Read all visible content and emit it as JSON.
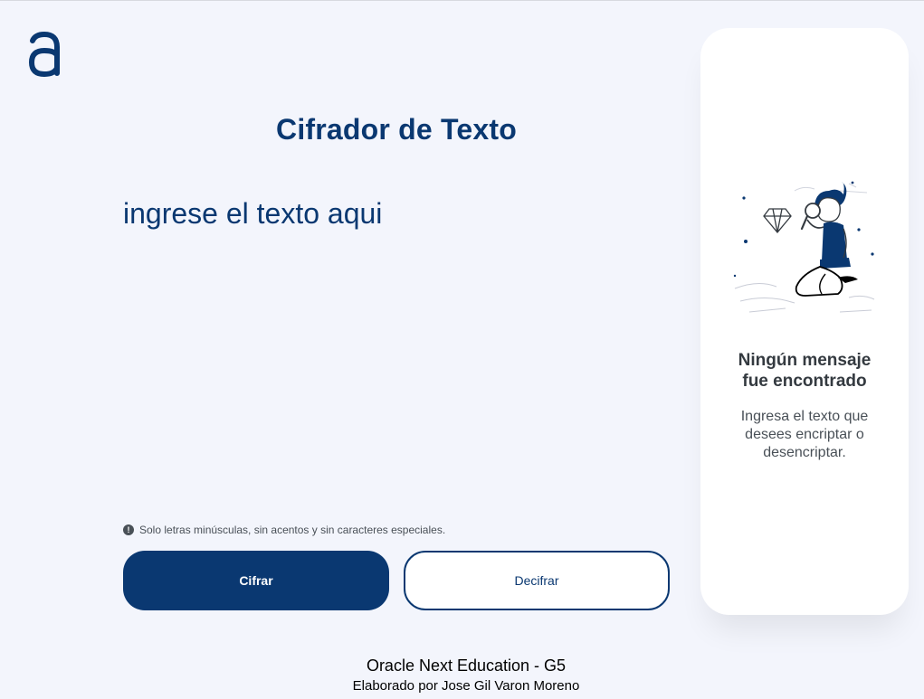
{
  "header": {
    "logo_icon": "alura-logo-icon",
    "title": "Cifrador de Texto"
  },
  "editor": {
    "placeholder": "ingrese el texto aqui",
    "value": ""
  },
  "hint": {
    "icon": "info-icon",
    "text": "Solo letras minúsculas, sin acentos y sin caracteres especiales."
  },
  "actions": {
    "encrypt_label": "Cifrar",
    "decrypt_label": "Decifrar"
  },
  "output_panel": {
    "illustration": "boy-with-magnifying-glass-illustration",
    "title": "Ningún mensaje fue encontrado",
    "text": "Ingresa el texto que desees encriptar o desencriptar."
  },
  "footer": {
    "line1": "Oracle Next Education - G5",
    "line2": "Elaborado por Jose Gil Varon Moreno"
  },
  "colors": {
    "background": "#f3f5fc",
    "primary": "#0a3871",
    "panel": "#ffffff",
    "text_dark": "#343a40"
  }
}
